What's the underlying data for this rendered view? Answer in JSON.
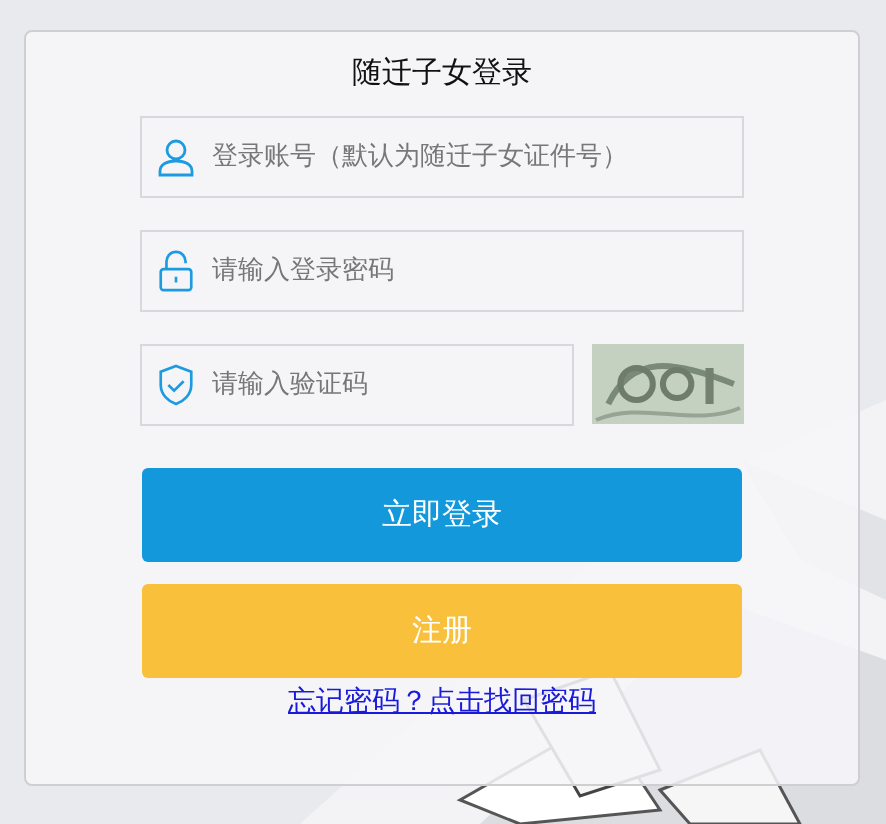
{
  "login_card": {
    "title": "随迁子女登录",
    "fields": [
      {
        "kind": "user",
        "placeholder": "登录账号（默认为随迁子女证件号）"
      },
      {
        "kind": "password",
        "placeholder": "请输入登录密码"
      },
      {
        "kind": "captcha",
        "placeholder": "请输入验证码"
      }
    ],
    "buttons": [
      {
        "kind": "primary",
        "label": "立即登录"
      },
      {
        "kind": "secondary",
        "label": "注册"
      }
    ],
    "forgot_link": "忘记密码？点击找回密码"
  }
}
